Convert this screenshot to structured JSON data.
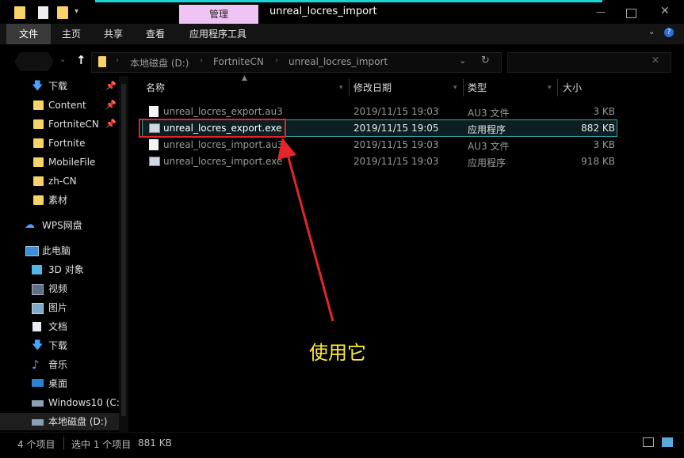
{
  "titlebar": {
    "manage_tab": "管理",
    "window_title": "unreal_locres_import",
    "quick_access": [
      "folder-icon",
      "properties-icon",
      "new-folder-icon",
      "customize-dropdown-icon"
    ],
    "controls": [
      "minimize-icon",
      "maximize-icon",
      "close-icon"
    ]
  },
  "ribbon": {
    "tabs": [
      "文件",
      "主页",
      "共享",
      "查看",
      "应用程序工具"
    ],
    "active_tab": "文件"
  },
  "address": {
    "crumbs": [
      "本地磁盘 (D:)",
      "FortniteCN",
      "unreal_locres_import"
    ],
    "search_placeholder": ""
  },
  "nav": {
    "quick_access": [
      {
        "label": "下载",
        "icon": "download-arrow-icon",
        "pinned": true
      },
      {
        "label": "Content",
        "icon": "folder-icon",
        "pinned": true
      },
      {
        "label": "FortniteCN",
        "icon": "folder-icon",
        "pinned": true
      },
      {
        "label": "Fortnite",
        "icon": "folder-icon",
        "pinned": false
      },
      {
        "label": "MobileFile",
        "icon": "folder-icon",
        "pinned": false
      },
      {
        "label": "zh-CN",
        "icon": "folder-icon",
        "pinned": false
      },
      {
        "label": "素材",
        "icon": "folder-icon",
        "pinned": false
      }
    ],
    "wps": "WPS网盘",
    "this_pc": "此电脑",
    "pc_items": [
      {
        "label": "3D 对象",
        "icon": "cube-icon"
      },
      {
        "label": "视频",
        "icon": "video-icon"
      },
      {
        "label": "图片",
        "icon": "picture-icon"
      },
      {
        "label": "文档",
        "icon": "document-icon"
      },
      {
        "label": "下载",
        "icon": "download-arrow-icon"
      },
      {
        "label": "音乐",
        "icon": "music-note-icon"
      },
      {
        "label": "桌面",
        "icon": "desktop-icon"
      },
      {
        "label": "Windows10 (C:",
        "icon": "drive-icon"
      },
      {
        "label": "本地磁盘 (D:)",
        "icon": "drive-icon"
      }
    ]
  },
  "columns": {
    "name": "名称",
    "date": "修改日期",
    "type": "类型",
    "size": "大小"
  },
  "files": [
    {
      "name": "unreal_locres_export.au3",
      "date": "2019/11/15 19:03",
      "type": "AU3 文件",
      "size": "3 KB",
      "icon": "au3-file-icon"
    },
    {
      "name": "unreal_locres_export.exe",
      "date": "2019/11/15 19:05",
      "type": "应用程序",
      "size": "882 KB",
      "icon": "exe-app-icon",
      "selected": true
    },
    {
      "name": "unreal_locres_import.au3",
      "date": "2019/11/15 19:03",
      "type": "AU3 文件",
      "size": "3 KB",
      "icon": "au3-file-icon"
    },
    {
      "name": "unreal_locres_import.exe",
      "date": "2019/11/15 19:03",
      "type": "应用程序",
      "size": "918 KB",
      "icon": "exe-app-icon"
    }
  ],
  "annotation": "使用它",
  "status": {
    "item_count": "4 个项目",
    "selected": "选中 1 个项目",
    "selected_size": "881 KB"
  },
  "colors": {
    "accent": "#19d4d6",
    "manage_tab": "#f0c3f5",
    "highlight": "#e3262a",
    "annotation": "#ffee33"
  }
}
